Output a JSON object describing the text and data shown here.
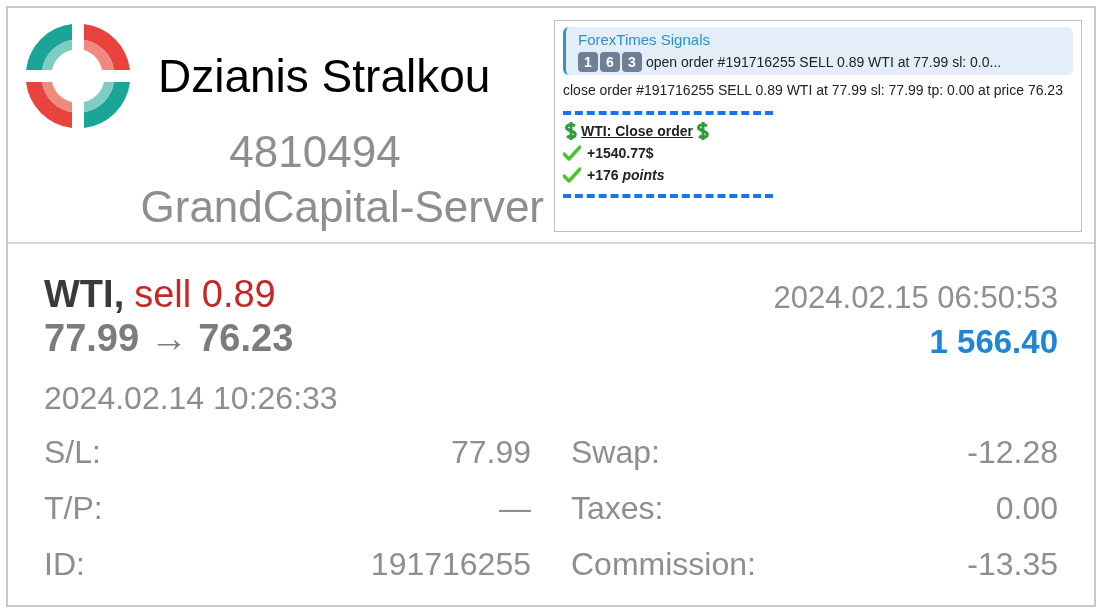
{
  "account": {
    "name": "Dzianis Stralkou",
    "number": "4810494",
    "server": "GrandCapital-Server"
  },
  "signal": {
    "channel": "ForexTimes Signals",
    "badges": [
      "1",
      "6",
      "3"
    ],
    "quote": "open order #191716255 SELL 0.89 WTI at 77.99 sl: 0.0...",
    "message": "close order #191716255 SELL 0.89 WTI at 77.99 sl: 77.99 tp: 0.00 at price 76.23",
    "result_title": "WTI: Close order",
    "results": [
      "+1540.77$",
      "+176 *points*"
    ]
  },
  "trade": {
    "symbol": "WTI,",
    "action": "sell 0.89",
    "prices": "77.99 → 76.23",
    "close_time": "2024.02.15 06:50:53",
    "profit": "1 566.40",
    "open_time": "2024.02.14 10:26:33",
    "left_fields": [
      {
        "label": "S/L:",
        "value": "77.99"
      },
      {
        "label": "T/P:",
        "value": "—"
      },
      {
        "label": "ID:",
        "value": "191716255"
      }
    ],
    "right_fields": [
      {
        "label": "Swap:",
        "value": "-12.28"
      },
      {
        "label": "Taxes:",
        "value": "0.00"
      },
      {
        "label": "Commission:",
        "value": "-13.35"
      }
    ]
  }
}
